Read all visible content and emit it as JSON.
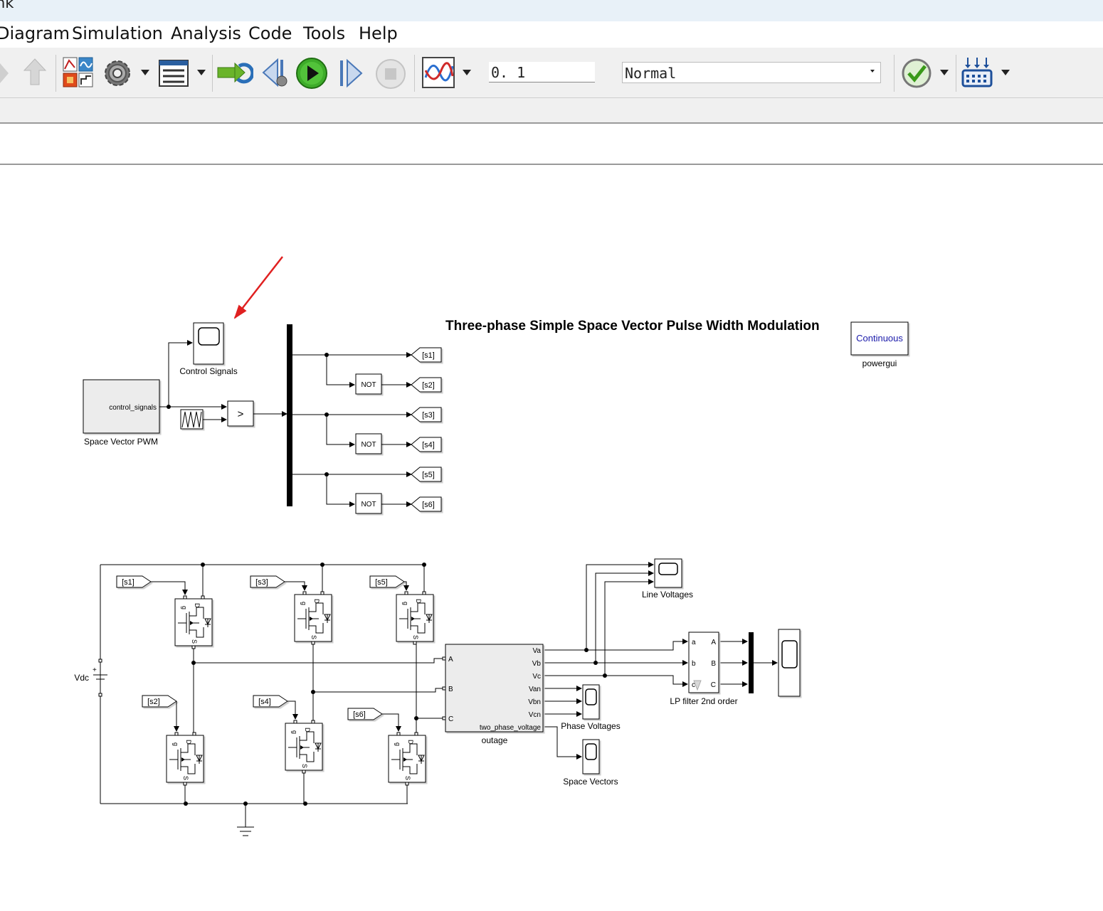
{
  "window": {
    "title_fragment": "nk"
  },
  "menu": [
    "Diagram",
    "Simulation",
    "Analysis",
    "Code",
    "Tools",
    "Help"
  ],
  "toolbar": {
    "stop_time": "0. 1",
    "sim_mode": "Normal",
    "icons": [
      "forward-arrow-icon",
      "up-arrow-icon",
      "library-browser-icon",
      "model-settings-gear-icon",
      "model-explorer-icon",
      "update-diagram-icon",
      "step-back-icon",
      "run-icon",
      "step-forward-icon",
      "stop-icon",
      "simulation-data-inspector-icon",
      "check-model-icon",
      "hardware-board-icon"
    ]
  },
  "diagram": {
    "title": "Three-phase Simple Space Vector Pulse Width Modulation",
    "powergui": {
      "mode": "Continuous",
      "label": "powergui"
    },
    "svpwm": {
      "port": "control_signals",
      "label": "Space Vector PWM"
    },
    "control_scope_label": "Control Signals",
    "relop_symbol": ">",
    "not_label": "NOT",
    "goto_tags": [
      "[s1]",
      "[s2]",
      "[s3]",
      "[s4]",
      "[s5]",
      "[s6]"
    ],
    "from_tags": [
      "[s1]",
      "[s3]",
      "[s5]",
      "[s2]",
      "[s4]",
      "[s6]"
    ],
    "mosfet_pins": {
      "gate": "g",
      "drain": "D",
      "source": "S"
    },
    "vdc_label": "Vdc",
    "vdc_plus": "+",
    "subsystem": {
      "inputs": [
        "A",
        "B",
        "C"
      ],
      "outputs": [
        "Va",
        "Vb",
        "Vc",
        "Van",
        "Vbn",
        "Vcn",
        "two_phase_voltage"
      ],
      "label": "outage"
    },
    "line_scope_label": "Line Voltages",
    "phase_scope_label": "Phase Voltages",
    "vector_scope_label": "Space Vectors",
    "filter": {
      "inputs": [
        "a",
        "b",
        "c"
      ],
      "outputs": [
        "A",
        "B",
        "C"
      ],
      "label": "LP filter 2nd order"
    }
  },
  "annotation": {
    "arrow_color": "#e02020"
  }
}
